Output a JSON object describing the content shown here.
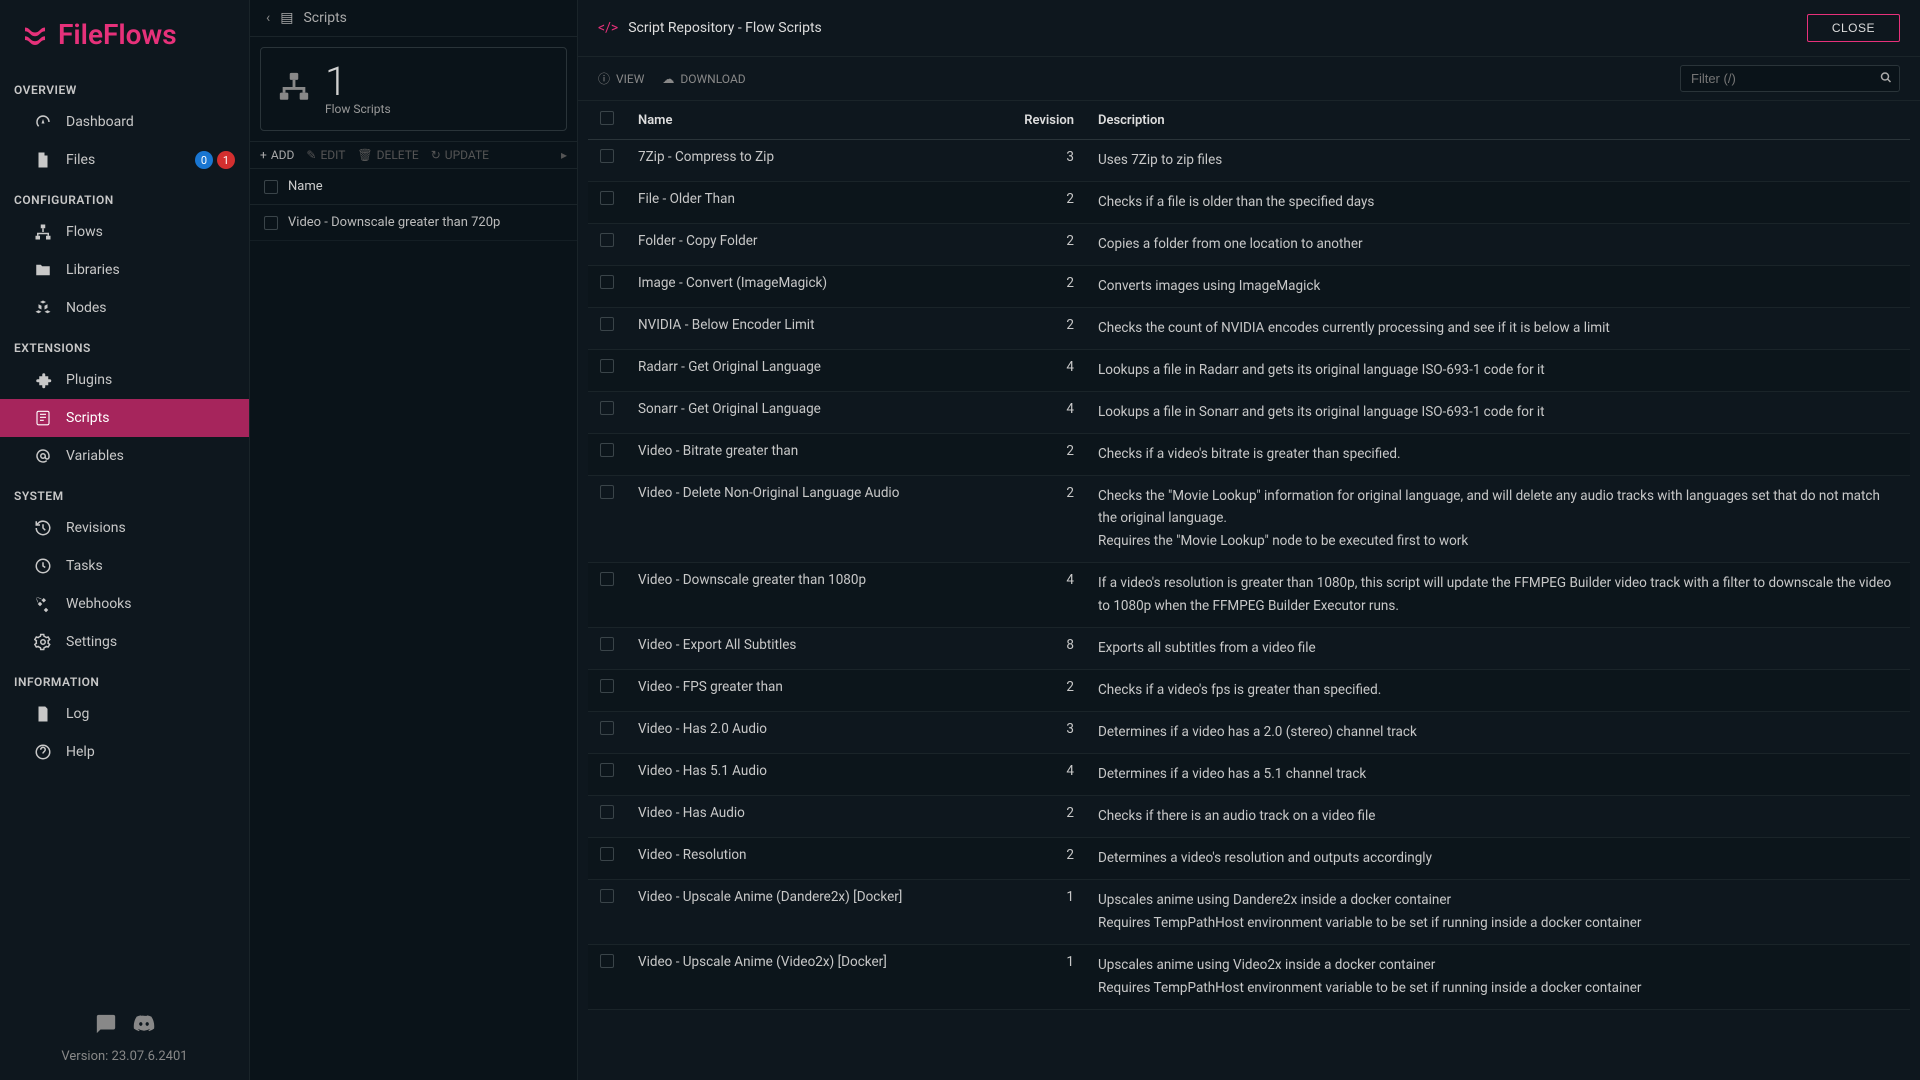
{
  "app": {
    "name": "FileFlows",
    "version": "Version: 23.07.6.2401"
  },
  "sidebar": {
    "sections": [
      {
        "title": "OVERVIEW",
        "items": [
          {
            "label": "Dashboard",
            "icon": "gauge"
          },
          {
            "label": "Files",
            "icon": "file",
            "badges": [
              {
                "text": "0",
                "color": "blue"
              },
              {
                "text": "1",
                "color": "red"
              }
            ]
          }
        ]
      },
      {
        "title": "CONFIGURATION",
        "items": [
          {
            "label": "Flows",
            "icon": "sitemap"
          },
          {
            "label": "Libraries",
            "icon": "folder"
          },
          {
            "label": "Nodes",
            "icon": "cubes"
          }
        ]
      },
      {
        "title": "EXTENSIONS",
        "items": [
          {
            "label": "Plugins",
            "icon": "puzzle"
          },
          {
            "label": "Scripts",
            "icon": "scroll",
            "active": true
          },
          {
            "label": "Variables",
            "icon": "at"
          }
        ]
      },
      {
        "title": "SYSTEM",
        "items": [
          {
            "label": "Revisions",
            "icon": "history"
          },
          {
            "label": "Tasks",
            "icon": "clock"
          },
          {
            "label": "Webhooks",
            "icon": "satellite"
          },
          {
            "label": "Settings",
            "icon": "cog"
          }
        ]
      },
      {
        "title": "INFORMATION",
        "items": [
          {
            "label": "Log",
            "icon": "file-alt"
          },
          {
            "label": "Help",
            "icon": "question"
          }
        ]
      }
    ]
  },
  "middle": {
    "breadcrumb": "Scripts",
    "tab": {
      "count": "1",
      "label": "Flow Scripts"
    },
    "toolbar": {
      "add": "ADD",
      "edit": "EDIT",
      "delete": "DELETE",
      "update": "UPDATE"
    },
    "header": "Name",
    "rows": [
      {
        "name": "Video - Downscale greater than 720p"
      }
    ]
  },
  "modal": {
    "title": "Script Repository - Flow Scripts",
    "close": "CLOSE",
    "toolbar": {
      "view": "VIEW",
      "download": "DOWNLOAD"
    },
    "filter_placeholder": "Filter (/)",
    "columns": {
      "name": "Name",
      "revision": "Revision",
      "description": "Description"
    },
    "rows": [
      {
        "name": "7Zip - Compress to Zip",
        "revision": "3",
        "description": [
          "Uses 7Zip to zip files"
        ]
      },
      {
        "name": "File - Older Than",
        "revision": "2",
        "description": [
          "Checks if a file is older than the specified days"
        ]
      },
      {
        "name": "Folder - Copy Folder",
        "revision": "2",
        "description": [
          "Copies a folder from one location to another"
        ]
      },
      {
        "name": "Image - Convert (ImageMagick)",
        "revision": "2",
        "description": [
          "Converts images using ImageMagick"
        ]
      },
      {
        "name": "NVIDIA - Below Encoder Limit",
        "revision": "2",
        "description": [
          "Checks the count of NVIDIA encodes currently processing and see if it is below a limit"
        ]
      },
      {
        "name": "Radarr - Get Original Language",
        "revision": "4",
        "description": [
          "Lookups a file in Radarr and gets its original language ISO-693-1 code for it"
        ]
      },
      {
        "name": "Sonarr - Get Original Language",
        "revision": "4",
        "description": [
          "Lookups a file in Sonarr and gets its original language ISO-693-1 code for it"
        ]
      },
      {
        "name": "Video - Bitrate greater than",
        "revision": "2",
        "description": [
          "Checks if a video's bitrate is greater than specified."
        ]
      },
      {
        "name": "Video - Delete Non-Original Language Audio",
        "revision": "2",
        "description": [
          "Checks the \"Movie Lookup\" information for original language, and will delete any audio tracks with languages set that do not match the original language.",
          "Requires the \"Movie Lookup\" node to be executed first to work"
        ]
      },
      {
        "name": "Video - Downscale greater than 1080p",
        "revision": "4",
        "description": [
          "If a video's resolution is greater than 1080p, this script will update the FFMPEG Builder video track with a filter to downscale the video to 1080p when the FFMPEG Builder Executor runs."
        ]
      },
      {
        "name": "Video - Export All Subtitles",
        "revision": "8",
        "description": [
          "Exports all subtitles from a video file"
        ]
      },
      {
        "name": "Video - FPS greater than",
        "revision": "2",
        "description": [
          "Checks if a video's fps is greater than specified."
        ]
      },
      {
        "name": "Video - Has 2.0 Audio",
        "revision": "3",
        "description": [
          "Determines if a video has a 2.0 (stereo) channel track"
        ]
      },
      {
        "name": "Video - Has 5.1 Audio",
        "revision": "4",
        "description": [
          "Determines if a video has a 5.1 channel track"
        ]
      },
      {
        "name": "Video - Has Audio",
        "revision": "2",
        "description": [
          "Checks if there is an audio track on a video file"
        ]
      },
      {
        "name": "Video - Resolution",
        "revision": "2",
        "description": [
          "Determines a video's resolution and outputs accordingly"
        ]
      },
      {
        "name": "Video - Upscale Anime (Dandere2x) [Docker]",
        "revision": "1",
        "description": [
          "Upscales anime using Dandere2x inside a docker container",
          "Requires TempPathHost environment variable to be set if running inside a docker container"
        ]
      },
      {
        "name": "Video - Upscale Anime (Video2x) [Docker]",
        "revision": "1",
        "description": [
          "Upscales anime using Video2x inside a docker container",
          "Requires TempPathHost environment variable to be set if running inside a docker container"
        ]
      }
    ]
  }
}
